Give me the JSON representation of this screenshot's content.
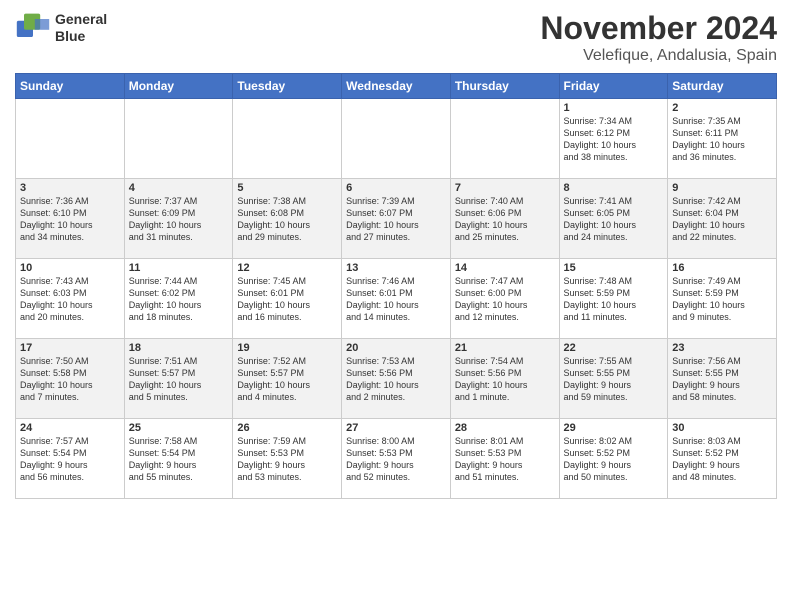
{
  "logo": {
    "line1": "General",
    "line2": "Blue"
  },
  "title": "November 2024",
  "subtitle": "Velefique, Andalusia, Spain",
  "header": {
    "days": [
      "Sunday",
      "Monday",
      "Tuesday",
      "Wednesday",
      "Thursday",
      "Friday",
      "Saturday"
    ]
  },
  "weeks": [
    {
      "days": [
        {
          "num": "",
          "info": ""
        },
        {
          "num": "",
          "info": ""
        },
        {
          "num": "",
          "info": ""
        },
        {
          "num": "",
          "info": ""
        },
        {
          "num": "",
          "info": ""
        },
        {
          "num": "1",
          "info": "Sunrise: 7:34 AM\nSunset: 6:12 PM\nDaylight: 10 hours\nand 38 minutes."
        },
        {
          "num": "2",
          "info": "Sunrise: 7:35 AM\nSunset: 6:11 PM\nDaylight: 10 hours\nand 36 minutes."
        }
      ]
    },
    {
      "days": [
        {
          "num": "3",
          "info": "Sunrise: 7:36 AM\nSunset: 6:10 PM\nDaylight: 10 hours\nand 34 minutes."
        },
        {
          "num": "4",
          "info": "Sunrise: 7:37 AM\nSunset: 6:09 PM\nDaylight: 10 hours\nand 31 minutes."
        },
        {
          "num": "5",
          "info": "Sunrise: 7:38 AM\nSunset: 6:08 PM\nDaylight: 10 hours\nand 29 minutes."
        },
        {
          "num": "6",
          "info": "Sunrise: 7:39 AM\nSunset: 6:07 PM\nDaylight: 10 hours\nand 27 minutes."
        },
        {
          "num": "7",
          "info": "Sunrise: 7:40 AM\nSunset: 6:06 PM\nDaylight: 10 hours\nand 25 minutes."
        },
        {
          "num": "8",
          "info": "Sunrise: 7:41 AM\nSunset: 6:05 PM\nDaylight: 10 hours\nand 24 minutes."
        },
        {
          "num": "9",
          "info": "Sunrise: 7:42 AM\nSunset: 6:04 PM\nDaylight: 10 hours\nand 22 minutes."
        }
      ]
    },
    {
      "days": [
        {
          "num": "10",
          "info": "Sunrise: 7:43 AM\nSunset: 6:03 PM\nDaylight: 10 hours\nand 20 minutes."
        },
        {
          "num": "11",
          "info": "Sunrise: 7:44 AM\nSunset: 6:02 PM\nDaylight: 10 hours\nand 18 minutes."
        },
        {
          "num": "12",
          "info": "Sunrise: 7:45 AM\nSunset: 6:01 PM\nDaylight: 10 hours\nand 16 minutes."
        },
        {
          "num": "13",
          "info": "Sunrise: 7:46 AM\nSunset: 6:01 PM\nDaylight: 10 hours\nand 14 minutes."
        },
        {
          "num": "14",
          "info": "Sunrise: 7:47 AM\nSunset: 6:00 PM\nDaylight: 10 hours\nand 12 minutes."
        },
        {
          "num": "15",
          "info": "Sunrise: 7:48 AM\nSunset: 5:59 PM\nDaylight: 10 hours\nand 11 minutes."
        },
        {
          "num": "16",
          "info": "Sunrise: 7:49 AM\nSunset: 5:59 PM\nDaylight: 10 hours\nand 9 minutes."
        }
      ]
    },
    {
      "days": [
        {
          "num": "17",
          "info": "Sunrise: 7:50 AM\nSunset: 5:58 PM\nDaylight: 10 hours\nand 7 minutes."
        },
        {
          "num": "18",
          "info": "Sunrise: 7:51 AM\nSunset: 5:57 PM\nDaylight: 10 hours\nand 5 minutes."
        },
        {
          "num": "19",
          "info": "Sunrise: 7:52 AM\nSunset: 5:57 PM\nDaylight: 10 hours\nand 4 minutes."
        },
        {
          "num": "20",
          "info": "Sunrise: 7:53 AM\nSunset: 5:56 PM\nDaylight: 10 hours\nand 2 minutes."
        },
        {
          "num": "21",
          "info": "Sunrise: 7:54 AM\nSunset: 5:56 PM\nDaylight: 10 hours\nand 1 minute."
        },
        {
          "num": "22",
          "info": "Sunrise: 7:55 AM\nSunset: 5:55 PM\nDaylight: 9 hours\nand 59 minutes."
        },
        {
          "num": "23",
          "info": "Sunrise: 7:56 AM\nSunset: 5:55 PM\nDaylight: 9 hours\nand 58 minutes."
        }
      ]
    },
    {
      "days": [
        {
          "num": "24",
          "info": "Sunrise: 7:57 AM\nSunset: 5:54 PM\nDaylight: 9 hours\nand 56 minutes."
        },
        {
          "num": "25",
          "info": "Sunrise: 7:58 AM\nSunset: 5:54 PM\nDaylight: 9 hours\nand 55 minutes."
        },
        {
          "num": "26",
          "info": "Sunrise: 7:59 AM\nSunset: 5:53 PM\nDaylight: 9 hours\nand 53 minutes."
        },
        {
          "num": "27",
          "info": "Sunrise: 8:00 AM\nSunset: 5:53 PM\nDaylight: 9 hours\nand 52 minutes."
        },
        {
          "num": "28",
          "info": "Sunrise: 8:01 AM\nSunset: 5:53 PM\nDaylight: 9 hours\nand 51 minutes."
        },
        {
          "num": "29",
          "info": "Sunrise: 8:02 AM\nSunset: 5:52 PM\nDaylight: 9 hours\nand 50 minutes."
        },
        {
          "num": "30",
          "info": "Sunrise: 8:03 AM\nSunset: 5:52 PM\nDaylight: 9 hours\nand 48 minutes."
        }
      ]
    }
  ]
}
